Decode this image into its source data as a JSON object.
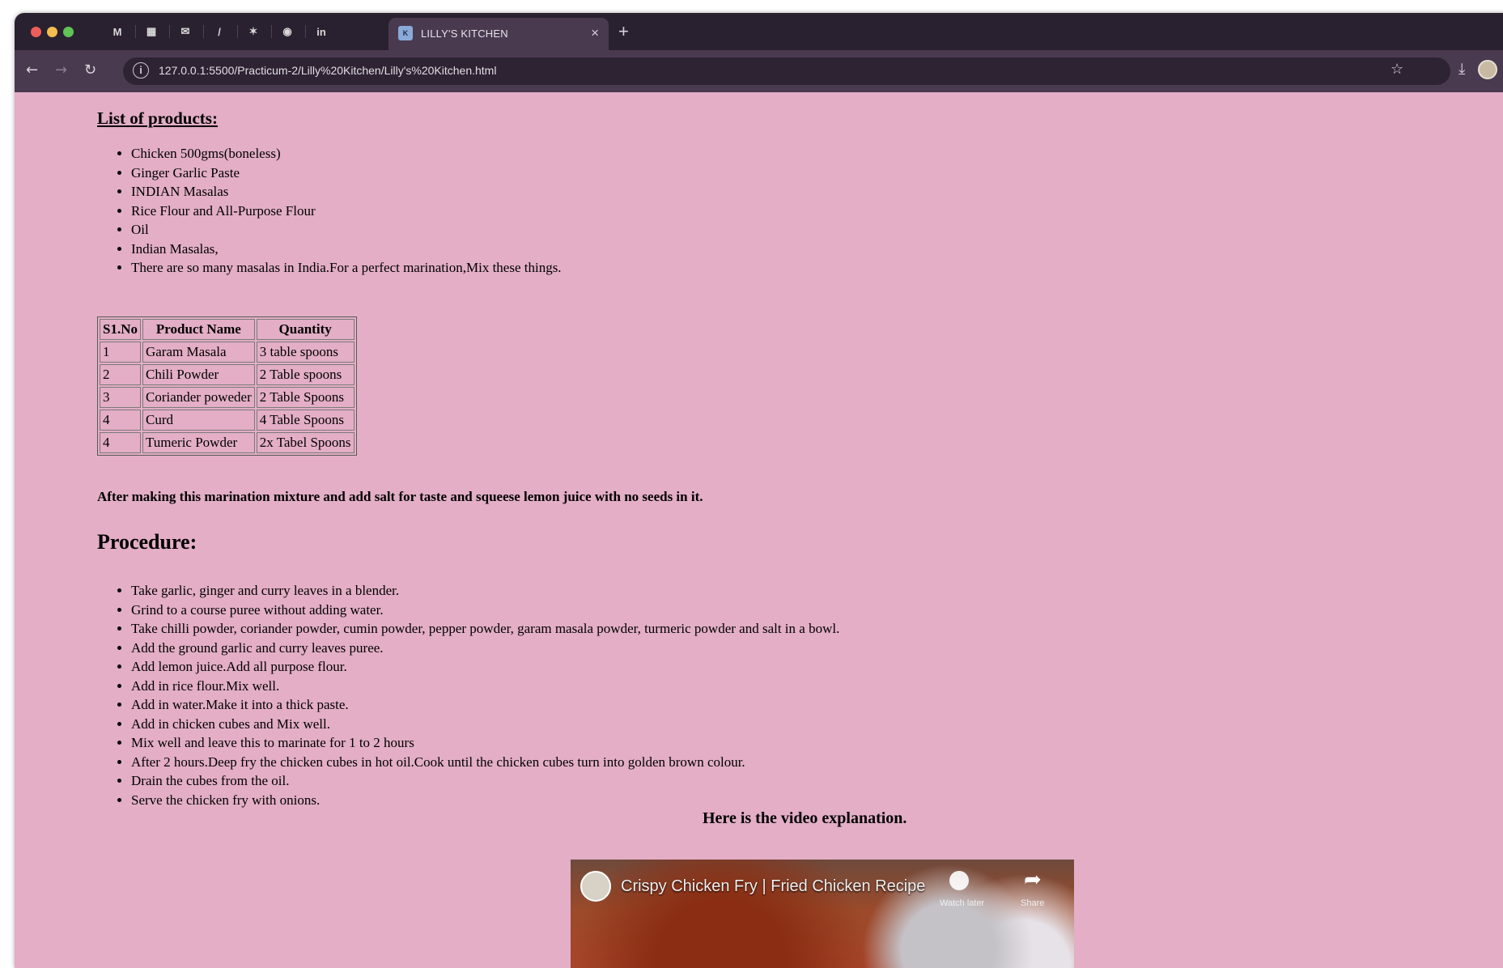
{
  "browser": {
    "pinned_tabs": [
      "M",
      "▦",
      "✉",
      "/",
      "✶",
      "◉",
      "in"
    ],
    "active_tab": {
      "favicon": "K",
      "title": "LILLY'S KITCHEN"
    },
    "new_tab": "+",
    "url": "127.0.0.1:5500/Practicum-2/Lilly%20Kitchen/Lilly's%20Kitchen.html"
  },
  "page": {
    "products_heading": "List of products:",
    "products": [
      "Chicken 500gms(boneless)",
      "Ginger Garlic Paste",
      "INDIAN Masalas",
      "Rice Flour and All-Purpose Flour",
      "Oil",
      "Indian Masalas,",
      "There are so many masalas in India.For a perfect marination,Mix these things."
    ],
    "table": {
      "headers": [
        "S1.No",
        "Product Name",
        "Quantity"
      ],
      "rows": [
        [
          "1",
          "Garam Masala",
          "3 table spoons"
        ],
        [
          "2",
          "Chili Powder",
          "2 Table spoons"
        ],
        [
          "3",
          "Coriander poweder",
          "2 Table Spoons"
        ],
        [
          "4",
          "Curd",
          "4 Table Spoons"
        ],
        [
          "4",
          "Tumeric Powder",
          "2x Tabel Spoons"
        ]
      ]
    },
    "note": "After making this marination mixture and add salt for taste and squeese lemon juice with no seeds in it.",
    "procedure_heading": "Procedure:",
    "procedure": [
      "Take garlic, ginger and curry leaves in a blender.",
      "Grind to a course puree without adding water.",
      "Take chilli powder, coriander powder, cumin powder, pepper powder, garam masala powder, turmeric powder and salt in a bowl.",
      "Add the ground garlic and curry leaves puree.",
      "Add lemon juice.Add all purpose flour.",
      "Add in rice flour.Mix well.",
      "Add in water.Make it into a thick paste.",
      "Add in chicken cubes and Mix well.",
      "Mix well and leave this to marinate for 1 to 2 hours",
      "After 2 hours.Deep fry the chicken cubes in hot oil.Cook until the chicken cubes turn into golden brown colour.",
      "Drain the cubes from the oil.",
      "Serve the chicken fry with onions."
    ],
    "video_caption": "Here is the video explanation.",
    "video": {
      "title": "Crispy Chicken Fry | Fried Chicken Recipe",
      "watch_later": "Watch later",
      "share": "Share"
    }
  }
}
